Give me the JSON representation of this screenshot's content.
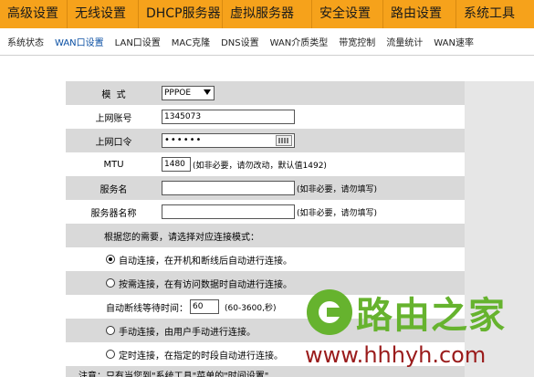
{
  "top_nav": [
    {
      "label": "高级设置"
    },
    {
      "label": "无线设置"
    },
    {
      "label": "DHCP服务器"
    },
    {
      "label": "虚拟服务器"
    },
    {
      "label": "安全设置"
    },
    {
      "label": "路由设置"
    },
    {
      "label": "系统工具"
    }
  ],
  "sub_nav": [
    {
      "label": "系统状态"
    },
    {
      "label": "WAN口设置"
    },
    {
      "label": "LAN口设置"
    },
    {
      "label": "MAC克隆"
    },
    {
      "label": "DNS设置"
    },
    {
      "label": "WAN介质类型"
    },
    {
      "label": "带宽控制"
    },
    {
      "label": "流量统计"
    },
    {
      "label": "WAN速率"
    }
  ],
  "form": {
    "mode_label": "模  式",
    "mode_value": "PPPOE",
    "account_label": "上网账号",
    "account_value": "1345073",
    "password_label": "上网口令",
    "password_value": "••••••",
    "mtu_label": "MTU",
    "mtu_value": "1480",
    "mtu_note": "(如非必要，请勿改动，默认值1492)",
    "service_name_label": "服务名",
    "service_name_value": "",
    "service_name_note": "(如非必要，请勿填写)",
    "server_name_label": "服务器名称",
    "server_name_value": "",
    "server_name_note": "(如非必要，请勿填写)",
    "connect_mode_prompt": "根据您的需要，请选择对应连接模式：",
    "option_auto": "自动连接，在开机和断线后自动进行连接。",
    "option_on_demand": "按需连接，在有访问数据时自动进行连接。",
    "idle_label": "自动断线等待时间：",
    "idle_value": "60",
    "idle_note": "(60-3600,秒)",
    "option_manual": "手动连接，由用户手动进行连接。",
    "option_timed": "定时连接，在指定的时段自动进行连接。",
    "partial_bottom": "注意：只有当您到\"系统工具\"菜单的\"时间设置\""
  },
  "watermark": {
    "brand": "路由之家",
    "url": "www.hhhyh.com"
  }
}
